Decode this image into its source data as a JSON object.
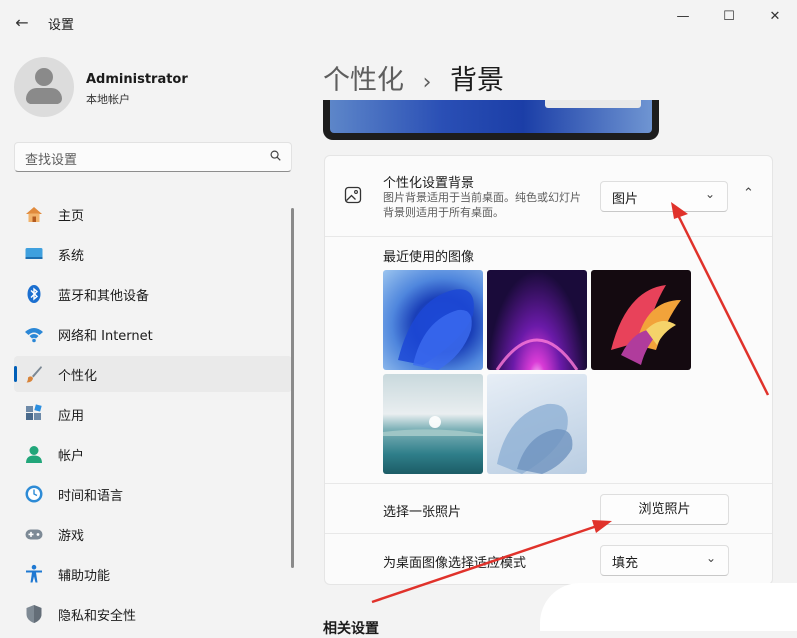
{
  "window": {
    "title": "设置",
    "back_icon": "back-arrow-icon",
    "minimize_icon": "minimize-icon",
    "maximize_icon": "maximize-icon",
    "close_icon": "close-icon"
  },
  "user": {
    "name": "Administrator",
    "account_type": "本地帐户",
    "avatar_icon": "person-icon"
  },
  "search": {
    "placeholder": "查找设置",
    "icon": "search-icon"
  },
  "sidebar": {
    "selected_index": 4,
    "accent_color": "#005fb8",
    "items": [
      {
        "label": "主页",
        "icon": "home-icon"
      },
      {
        "label": "系统",
        "icon": "display-icon"
      },
      {
        "label": "蓝牙和其他设备",
        "icon": "bluetooth-icon"
      },
      {
        "label": "网络和 Internet",
        "icon": "wifi-icon"
      },
      {
        "label": "个性化",
        "icon": "brush-icon"
      },
      {
        "label": "应用",
        "icon": "apps-icon"
      },
      {
        "label": "帐户",
        "icon": "account-icon"
      },
      {
        "label": "时间和语言",
        "icon": "clock-globe-icon"
      },
      {
        "label": "游戏",
        "icon": "gamepad-icon"
      },
      {
        "label": "辅助功能",
        "icon": "accessibility-icon"
      },
      {
        "label": "隐私和安全性",
        "icon": "shield-icon"
      }
    ]
  },
  "main": {
    "breadcrumb_parent": "个性化",
    "breadcrumb_separator": "›",
    "breadcrumb_current": "背景",
    "background_setting": {
      "icon": "image-icon",
      "title": "个性化设置背景",
      "description": "图片背景适用于当前桌面。纯色或幻灯片背景则适用于所有桌面。",
      "value": "图片",
      "dropdown_icon": "chevron-down-icon",
      "collapse_icon": "chevron-up-icon"
    },
    "recent_images": {
      "label": "最近使用的图像",
      "images": [
        "bloom-blue-wallpaper",
        "purple-arc-wallpaper",
        "colorful-flow-wallpaper",
        "lake-sunrise-wallpaper",
        "light-blue-bloom-wallpaper"
      ]
    },
    "choose_photo": {
      "label": "选择一张照片",
      "button": "浏览照片"
    },
    "fit_mode": {
      "label": "为桌面图像选择适应模式",
      "value": "填充",
      "dropdown_icon": "chevron-down-icon"
    },
    "related_heading": "相关设置"
  }
}
